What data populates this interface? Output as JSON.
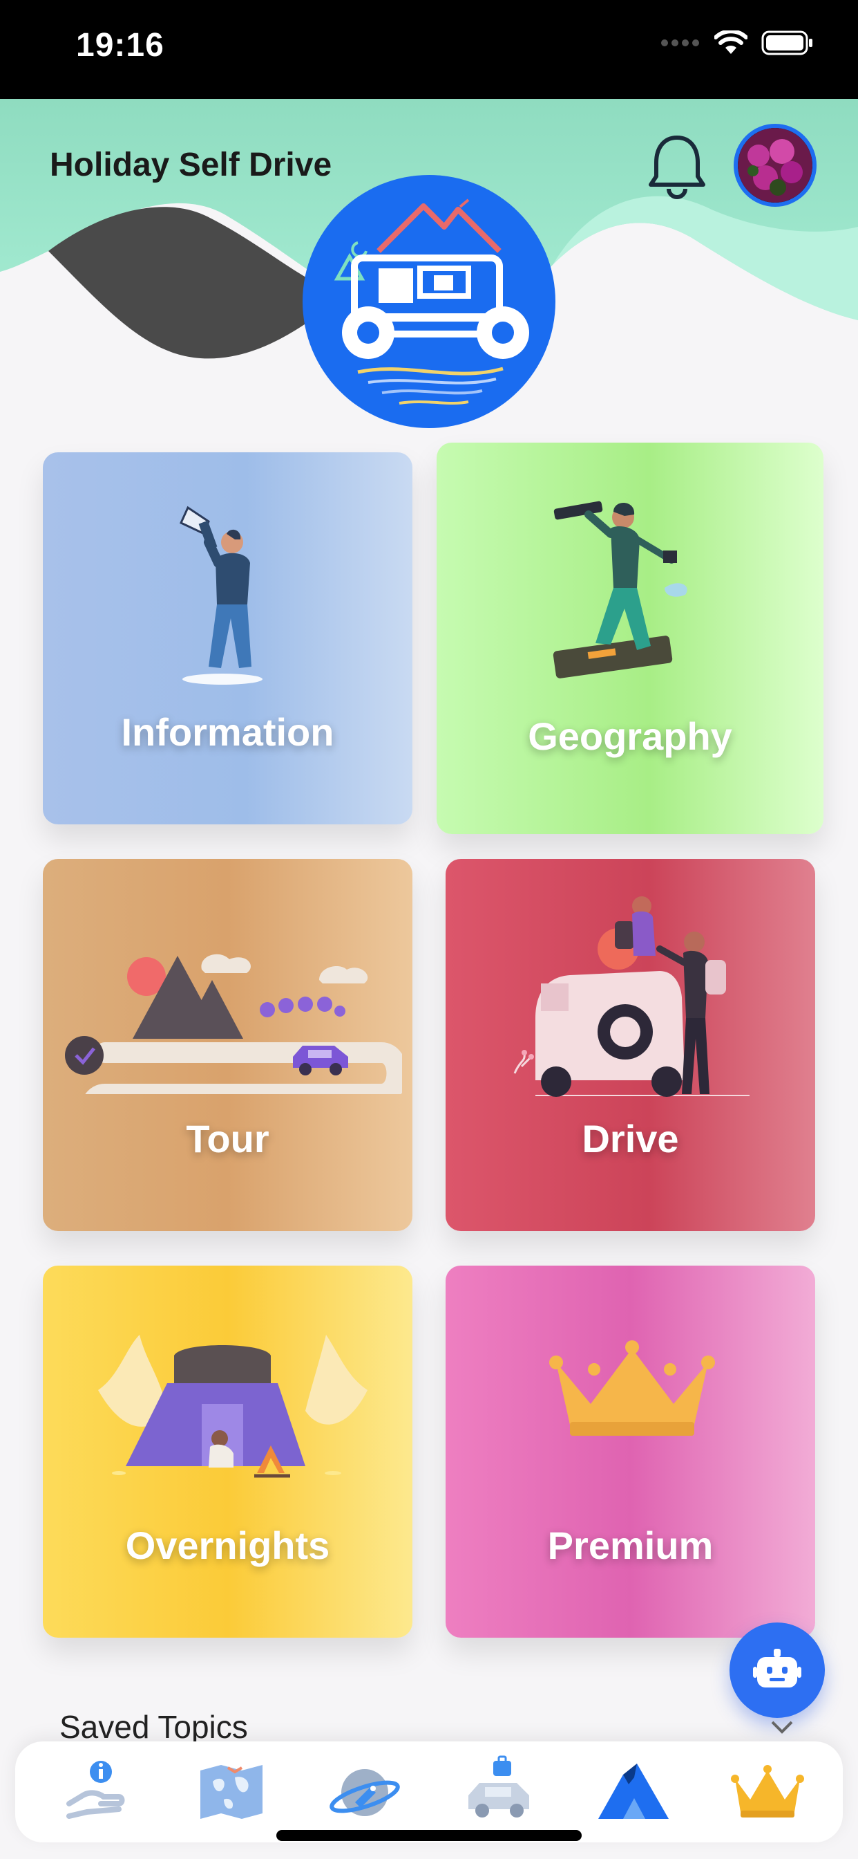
{
  "status_bar": {
    "time": "19:16"
  },
  "header": {
    "title": "Holiday Self Drive",
    "accent_color": "#1e6ef0",
    "wave_color": "#9fe3c8"
  },
  "cards": [
    {
      "id": "information",
      "label": "Information",
      "icon": "megaphone-person-icon"
    },
    {
      "id": "geography",
      "label": "Geography",
      "icon": "telescope-explorer-icon"
    },
    {
      "id": "tour",
      "label": "Tour",
      "icon": "road-trip-map-icon"
    },
    {
      "id": "drive",
      "label": "Drive",
      "icon": "jeep-travelers-icon"
    },
    {
      "id": "overnights",
      "label": "Overnights",
      "icon": "camping-tent-icon"
    },
    {
      "id": "premium",
      "label": "Premium",
      "icon": "crown-icon"
    }
  ],
  "fab": {
    "icon": "robot-icon"
  },
  "saved_topics": {
    "label": "Saved Topics"
  },
  "tabbar": {
    "items": [
      {
        "icon": "info-hand-icon"
      },
      {
        "icon": "world-map-icon"
      },
      {
        "icon": "planet-rocket-icon"
      },
      {
        "icon": "travel-car-icon"
      },
      {
        "icon": "mountain-tent-icon"
      },
      {
        "icon": "crown-icon"
      }
    ]
  }
}
